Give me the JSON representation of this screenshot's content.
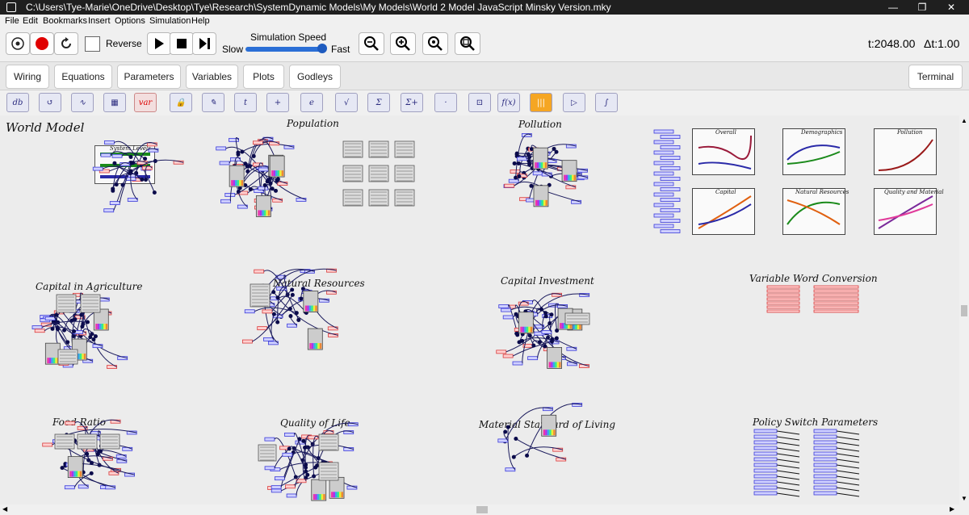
{
  "window": {
    "title": "C:\\Users\\Tye-Marie\\OneDrive\\Desktop\\Tye\\Research\\SystemDynamic Models\\My Models\\World 2 Model JavaScript Minsky Version.mky",
    "controls": [
      "—",
      "❐",
      "✕"
    ]
  },
  "menu": [
    "File",
    "Edit",
    "Bookmarks",
    "Insert",
    "Options",
    "Simulation",
    "Help"
  ],
  "toolbar": {
    "reverse_label": "Reverse",
    "speed_title": "Simulation Speed",
    "slow_label": "Slow",
    "fast_label": "Fast",
    "speed_value": 0.82,
    "time": "t:2048.00",
    "delta_t": "Δt:1.00"
  },
  "tabs": [
    "Wiring",
    "Equations",
    "Parameters",
    "Variables",
    "Plots",
    "Godleys"
  ],
  "terminal_label": "Terminal",
  "icon_tools": [
    "db",
    "↺",
    "∿",
    "▦",
    "var",
    "🔒",
    "✎",
    "t",
    "+",
    "e",
    "√",
    "Σ",
    "Σ+",
    "·",
    "⊡",
    "f(x)",
    "|||",
    "▷",
    "∫"
  ],
  "canvas": {
    "groups": [
      "World Model",
      "Population",
      "Pollution",
      "Capital in Agriculture",
      "Natural Resources",
      "Capital Investment",
      "Variable Word Conversion",
      "Food Ratio",
      "Quality of Life",
      "Material Standard of Living",
      "Policy Switch Parameters"
    ],
    "system_levels_title": "System Levels",
    "plots": [
      "Overall",
      "Demographics",
      "Pollution",
      "Capital",
      "Natural Resources",
      "Quality and Material"
    ]
  },
  "colors": {
    "accent_red": "#e00000",
    "wire": "#1a1a5c",
    "var_blue": "#3b3bd9",
    "param_red": "#d93b3b"
  }
}
